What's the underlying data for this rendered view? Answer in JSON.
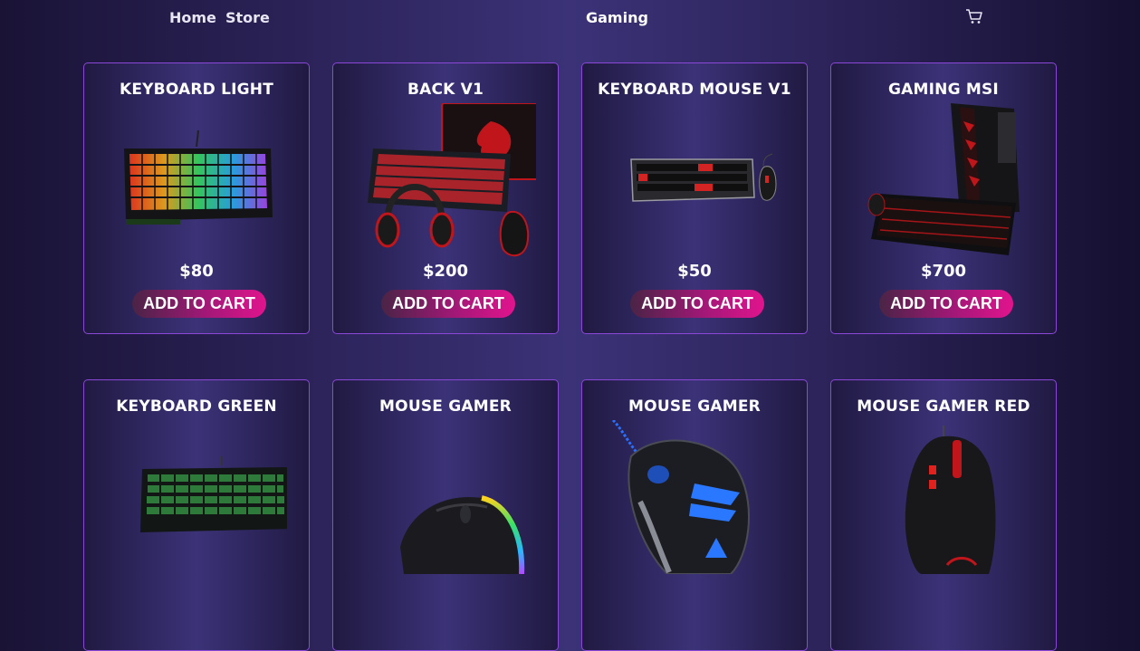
{
  "nav": {
    "home_label": "Home",
    "store_label": "Store",
    "brand": "Gaming",
    "cart_icon": "cart-icon"
  },
  "products": [
    {
      "title": "KEYBOARD LIGHT",
      "price": "$80",
      "button": "ADD TO CART",
      "image": "rgb-keyboard"
    },
    {
      "title": "BACK V1",
      "price": "$200",
      "button": "ADD TO CART",
      "image": "keyboard-headset-mouse-mousepad-bundle"
    },
    {
      "title": "KEYBOARD MOUSE V1",
      "price": "$50",
      "button": "ADD TO CART",
      "image": "keyboard-mouse-combo"
    },
    {
      "title": "GAMING MSI",
      "price": "$700",
      "button": "ADD TO CART",
      "image": "gaming-pc-tower-keyboard"
    },
    {
      "title": "KEYBOARD GREEN",
      "price": "",
      "button": "",
      "image": "green-keyboard"
    },
    {
      "title": "MOUSE GAMER",
      "price": "",
      "button": "",
      "image": "rgb-gaming-mouse"
    },
    {
      "title": "MOUSE GAMER",
      "price": "",
      "button": "",
      "image": "blue-gaming-mouse"
    },
    {
      "title": "MOUSE GAMER RED",
      "price": "",
      "button": "",
      "image": "red-gaming-mouse"
    }
  ],
  "colors": {
    "card_border": "#8a47d8",
    "button_start": "#4a2446",
    "button_end": "#e1148e",
    "page_center": "#3b3278"
  }
}
